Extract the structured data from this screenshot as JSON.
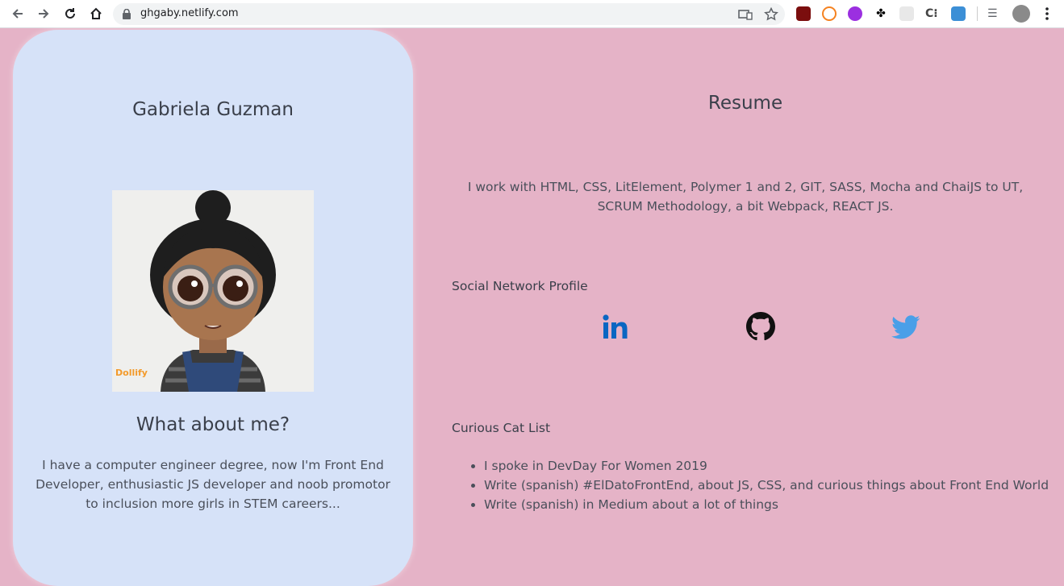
{
  "browser": {
    "url": "ghgaby.netlify.com"
  },
  "profile": {
    "name": "Gabriela Guzman",
    "avatar_watermark": "Dollify",
    "about_title": "What about me?",
    "about_text": "I have a computer engineer degree, now I'm Front End Developer, enthusiastic JS developer and noob promotor to inclusion more girls in STEM careers..."
  },
  "resume": {
    "title": "Resume",
    "text": "I work with HTML, CSS, LitElement, Polymer 1 and 2, GIT, SASS, Mocha and ChaiJS to UT, SCRUM Methodology, a bit Webpack, REACT JS.",
    "social_title": "Social Network Profile",
    "social_icons": [
      "linkedin-icon",
      "github-icon",
      "twitter-icon"
    ],
    "curious_title": "Curious Cat List",
    "curious_items": [
      "I spoke in DevDay For Women 2019",
      "Write (spanish) #ElDatoFrontEnd, about JS, CSS, and curious things about Front End World",
      "Write (spanish) in Medium about a lot of things"
    ]
  },
  "colors": {
    "page_bg": "#e5b3c7",
    "card_bg": "#d6e2f8",
    "linkedin": "#0a66c2",
    "twitter": "#4a9fe8"
  }
}
